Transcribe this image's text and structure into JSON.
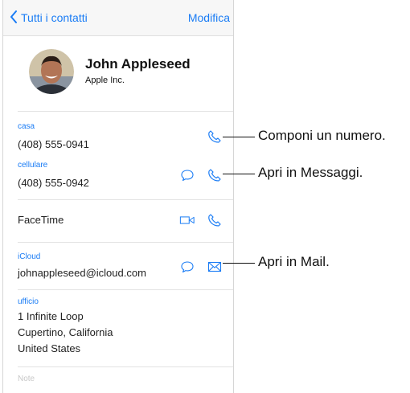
{
  "navbar": {
    "back_label": "Tutti i contatti",
    "edit_label": "Modifica"
  },
  "contact": {
    "name": "John Appleseed",
    "company": "Apple Inc."
  },
  "fields": {
    "home": {
      "label": "casa",
      "value": "(408) 555-0941"
    },
    "mobile": {
      "label": "cellulare",
      "value": "(408) 555-0942"
    },
    "facetime": {
      "label": "FaceTime"
    },
    "icloud": {
      "label": "iCloud",
      "value": "johnappleseed@icloud.com"
    },
    "work": {
      "label": "ufficio",
      "line1": "1 Infinite Loop",
      "line2": "Cupertino, California",
      "line3": "United States"
    },
    "notes": {
      "placeholder": "Note"
    }
  },
  "callouts": {
    "call": "Componi un numero.",
    "message": "Apri in Messaggi.",
    "mail": "Apri in Mail."
  },
  "colors": {
    "accent": "#1a7cf5",
    "navbar_bg": "#f7f7f7",
    "separator": "#e3e3e3"
  },
  "icons": [
    "chevron-left-icon",
    "phone-icon",
    "message-bubble-icon",
    "video-camera-icon",
    "envelope-icon"
  ]
}
